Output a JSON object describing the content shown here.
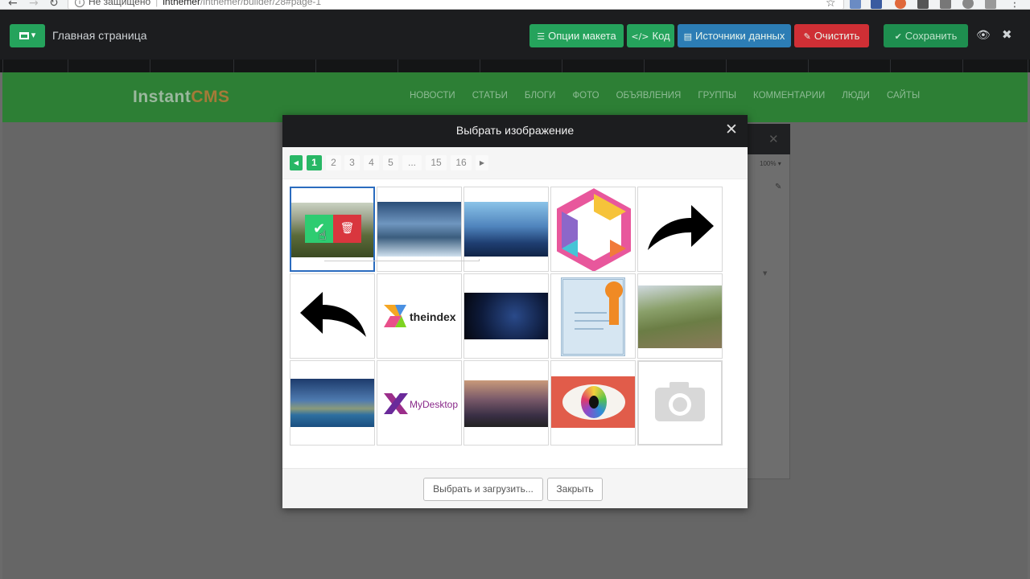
{
  "browser": {
    "security_label": "Не защищено",
    "url_host": "inthemer",
    "url_path": "/inthemer/builder/28#page-1"
  },
  "builder": {
    "page_title": "Главная страница",
    "buttons": {
      "layout_options": "Опции макета",
      "code": "Код",
      "data_sources": "Источники данных",
      "clear": "Очистить",
      "save": "Сохранить"
    },
    "colors": {
      "green": "#25a35c",
      "blue": "#2c7db5",
      "red": "#cf2f35",
      "save_green": "#1e8e4f"
    }
  },
  "site": {
    "logo_instant": "Instant",
    "logo_cms": "CMS",
    "nav": [
      "НОВОСТИ",
      "СТАТЬИ",
      "БЛОГИ",
      "ФОТО",
      "ОБЪЯВЛЕНИЯ",
      "ГРУППЫ",
      "КОММЕНТАРИИ",
      "ЛЮДИ",
      "САЙТЫ"
    ],
    "zoom": "100%"
  },
  "modal": {
    "title": "Выбрать изображение",
    "pagination": [
      "1",
      "2",
      "3",
      "4",
      "5",
      "...",
      "15",
      "16"
    ],
    "active_page": "1",
    "images": [
      {
        "name": "misty-field",
        "selected": true
      },
      {
        "name": "mountain-lake"
      },
      {
        "name": "blue-mountains"
      },
      {
        "name": "colorful-cube-logo"
      },
      {
        "name": "arrow-right-black"
      },
      {
        "name": "arrow-left-black"
      },
      {
        "name": "theindex-logo",
        "text": "theindex"
      },
      {
        "name": "night-sky"
      },
      {
        "name": "certificate"
      },
      {
        "name": "great-wall"
      },
      {
        "name": "island-horizon"
      },
      {
        "name": "mydesktop-logo",
        "text": "MyDesktop"
      },
      {
        "name": "city-skyline"
      },
      {
        "name": "rainbow-eye"
      },
      {
        "name": "camera-placeholder"
      }
    ],
    "footer": {
      "select_upload": "Выбрать и загрузить...",
      "close": "Закрыть"
    }
  }
}
